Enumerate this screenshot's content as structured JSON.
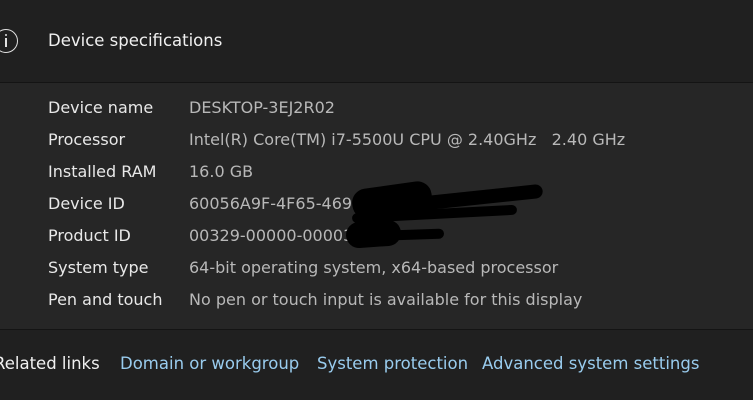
{
  "header": {
    "icon": "info-icon",
    "title": "Device specifications"
  },
  "specs": [
    {
      "label": "Device name",
      "value": "DESKTOP-3EJ2R02"
    },
    {
      "label": "Processor",
      "value": "Intel(R) Core(TM) i7-5500U CPU @ 2.40GHz   2.40 GHz"
    },
    {
      "label": "Installed RAM",
      "value": "16.0 GB"
    },
    {
      "label": "Device ID",
      "value": "60056A9F-4F65-469"
    },
    {
      "label": "Product ID",
      "value": "00329-00000-00003-A"
    },
    {
      "label": "System type",
      "value": "64-bit operating system, x64-based processor"
    },
    {
      "label": "Pen and touch",
      "value": "No pen or touch input is available for this display"
    }
  ],
  "related": {
    "title": "Related links",
    "links": [
      {
        "label": "Domain or workgroup"
      },
      {
        "label": "System protection"
      },
      {
        "label": "Advanced system settings"
      }
    ]
  },
  "colors": {
    "background": "#1c1c1c",
    "header_bg": "#202020",
    "specs_bg": "#262626",
    "link": "#99ccee"
  }
}
